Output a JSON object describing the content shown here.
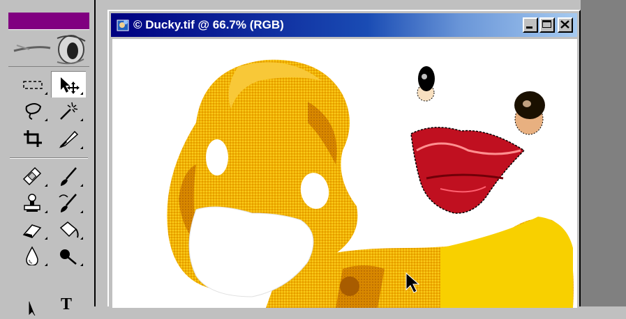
{
  "window": {
    "title": "© Ducky.tif @ 66.7% (RGB)",
    "buttons": [
      "minimize",
      "maximize",
      "close"
    ]
  },
  "toolbox": {
    "title_color": "#800080",
    "selected_tool": "move",
    "tools": [
      {
        "name": "marquee",
        "icon": "marquee-icon"
      },
      {
        "name": "move",
        "icon": "move-icon"
      },
      {
        "name": "lasso",
        "icon": "lasso-icon"
      },
      {
        "name": "magic-wand",
        "icon": "magic-wand-icon"
      },
      {
        "name": "crop",
        "icon": "crop-icon"
      },
      {
        "name": "slice",
        "icon": "slice-icon"
      },
      {
        "name": "healing-brush",
        "icon": "bandage-icon"
      },
      {
        "name": "brush",
        "icon": "brush-icon"
      },
      {
        "name": "clone-stamp",
        "icon": "stamp-icon"
      },
      {
        "name": "history-brush",
        "icon": "history-brush-icon"
      },
      {
        "name": "eraser",
        "icon": "eraser-icon"
      },
      {
        "name": "paint-bucket",
        "icon": "bucket-icon"
      },
      {
        "name": "blur",
        "icon": "drop-icon"
      },
      {
        "name": "dodge",
        "icon": "dodge-icon"
      },
      {
        "name": "path-select",
        "icon": "path-select-icon"
      },
      {
        "name": "type",
        "icon": "type-icon"
      }
    ]
  },
  "type_tool_label": "T",
  "colors": {
    "duck_yellow": "#f5b800",
    "duck_orange": "#e09a00",
    "lips_red": "#c01020",
    "titlebar_start": "#000080",
    "titlebar_end": "#a6caf0"
  }
}
